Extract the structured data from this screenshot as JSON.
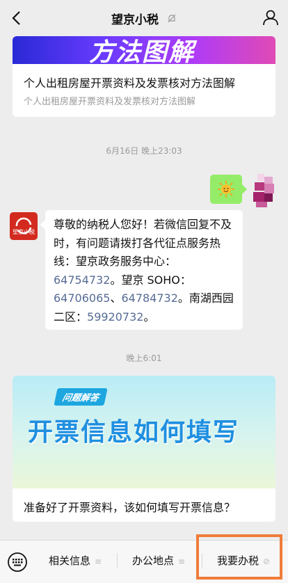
{
  "header": {
    "title": "望京小税"
  },
  "article_card_1": {
    "banner_text": "方法图解",
    "title": "个人出租房屋开票资料及发票核对方法图解",
    "subtitle": "个人出租房屋开票资料及发票核对方法图解"
  },
  "chat": {
    "timestamp_1": "6月16日 晚上23:03",
    "timestamp_2": "晚上6:01",
    "official_avatar_text": "望京小税",
    "message": {
      "intro": "尊敬的纳税人您好！若微信回复不及时，有问题请拨打各代征点服务热线：望京政务服务中心：",
      "phone_1": "64754732",
      "text_2": "。望京 SOHO：",
      "phone_2": "64706065",
      "text_3": "、",
      "phone_3": "64784732",
      "text_4": "。南湖西园二区：",
      "phone_4": "59920732",
      "text_5": "。"
    }
  },
  "article_card_2": {
    "tag": "问题解答",
    "banner_title": "开票信息如何填写",
    "caption": "准备好了开票资料，该如何填写开票信息？"
  },
  "bottom_menu": {
    "items": [
      {
        "label": "相关信息"
      },
      {
        "label": "办公地点"
      },
      {
        "label": "我要办税"
      }
    ]
  },
  "colors": {
    "accent_link": "#576b95",
    "bubble_green": "#95ec69",
    "highlight_orange": "#f07c3a"
  }
}
